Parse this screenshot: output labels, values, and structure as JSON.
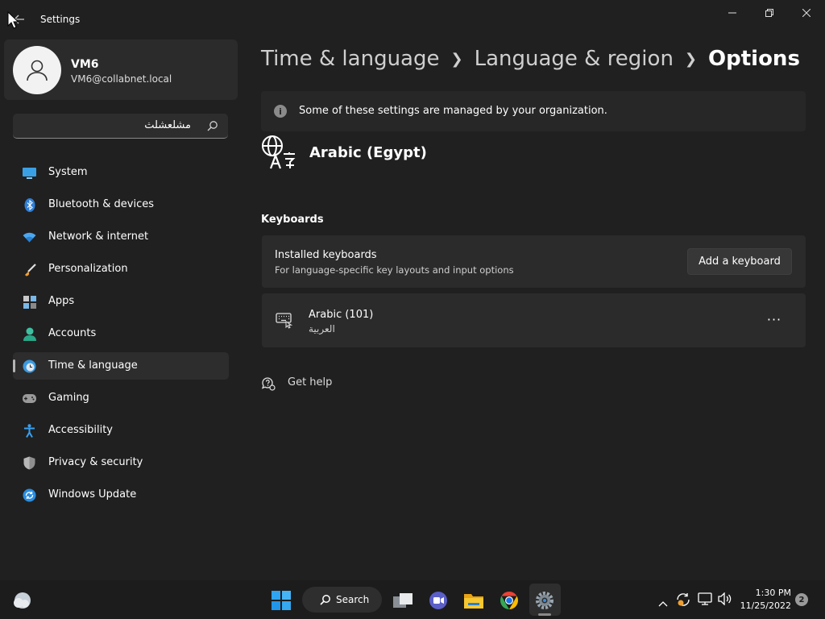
{
  "window": {
    "title": "Settings"
  },
  "profile": {
    "name": "VM6",
    "email": "VM6@collabnet.local"
  },
  "search": {
    "value": "مشلعشلث"
  },
  "nav": {
    "items": [
      {
        "label": "System",
        "icon": "monitor-icon"
      },
      {
        "label": "Bluetooth & devices",
        "icon": "bluetooth-icon"
      },
      {
        "label": "Network & internet",
        "icon": "wifi-icon"
      },
      {
        "label": "Personalization",
        "icon": "brush-icon"
      },
      {
        "label": "Apps",
        "icon": "apps-icon"
      },
      {
        "label": "Accounts",
        "icon": "person-icon"
      },
      {
        "label": "Time & language",
        "icon": "clock-globe-icon",
        "active": true
      },
      {
        "label": "Gaming",
        "icon": "gamepad-icon"
      },
      {
        "label": "Accessibility",
        "icon": "accessibility-icon"
      },
      {
        "label": "Privacy & security",
        "icon": "shield-icon"
      },
      {
        "label": "Windows Update",
        "icon": "update-icon"
      }
    ]
  },
  "breadcrumb": {
    "level1": "Time & language",
    "level2": "Language & region",
    "current": "Options"
  },
  "info_bar": {
    "text": "Some of these settings are managed by your organization."
  },
  "language": {
    "title": "Arabic (Egypt)"
  },
  "keyboards": {
    "heading": "Keyboards",
    "installed_title": "Installed keyboards",
    "installed_subtitle": "For language-specific key layouts and input options",
    "add_button": "Add a keyboard",
    "items": [
      {
        "name": "Arabic (101)",
        "native": "العربية"
      }
    ],
    "more_label": "···"
  },
  "help": {
    "label": "Get help"
  },
  "taskbar": {
    "search_label": "Search",
    "time": "1:30 PM",
    "date": "11/25/2022",
    "notifications": "2"
  },
  "colors": {
    "background": "#202020",
    "card": "#2b2b2b",
    "taskbar": "#1c1c1c",
    "accent": "#4cc2ff"
  }
}
